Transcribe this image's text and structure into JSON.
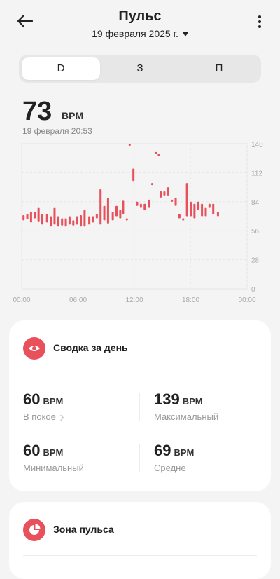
{
  "header": {
    "title": "Пульс",
    "date": "19 февраля 2025 г."
  },
  "tabs": [
    {
      "label": "D",
      "active": true
    },
    {
      "label": "З",
      "active": false
    },
    {
      "label": "П",
      "active": false
    }
  ],
  "current": {
    "value": "73",
    "unit": "BPM",
    "timestamp": "19 февраля 20:53"
  },
  "chart_data": {
    "type": "bar",
    "y_ticks": [
      "140",
      "112",
      "84",
      "56",
      "28",
      "0"
    ],
    "x_ticks": [
      "00:00",
      "06:00",
      "12:00",
      "18:00",
      "00:00"
    ],
    "ylim": [
      0,
      140
    ],
    "xlim_hours": [
      0,
      24
    ],
    "accent": "#e8505b",
    "series": [
      {
        "values": [
          [
            0.2,
            66,
            71
          ],
          [
            0.6,
            67,
            72
          ],
          [
            1.0,
            64,
            74
          ],
          [
            1.4,
            68,
            74
          ],
          [
            1.8,
            65,
            78
          ],
          [
            2.2,
            62,
            72
          ],
          [
            2.7,
            64,
            72
          ],
          [
            3.1,
            60,
            70
          ],
          [
            3.5,
            62,
            78
          ],
          [
            3.9,
            60,
            70
          ],
          [
            4.3,
            61,
            68
          ],
          [
            4.7,
            60,
            68
          ],
          [
            5.1,
            62,
            70
          ],
          [
            5.5,
            61,
            66
          ],
          [
            5.9,
            62,
            70
          ],
          [
            6.3,
            60,
            71
          ],
          [
            6.7,
            60,
            76
          ],
          [
            7.2,
            62,
            70
          ],
          [
            7.6,
            64,
            70
          ],
          [
            8.0,
            68,
            72
          ],
          [
            8.4,
            62,
            96
          ],
          [
            8.8,
            66,
            80
          ],
          [
            9.2,
            63,
            88
          ],
          [
            9.7,
            66,
            74
          ],
          [
            10.1,
            70,
            80
          ],
          [
            10.5,
            68,
            76
          ],
          [
            10.8,
            72,
            85
          ],
          [
            11.2,
            66,
            68
          ],
          [
            11.5,
            139,
            140
          ],
          [
            11.9,
            104,
            116
          ],
          [
            12.3,
            80,
            84
          ],
          [
            12.7,
            78,
            82
          ],
          [
            13.1,
            76,
            82
          ],
          [
            13.6,
            78,
            86
          ],
          [
            13.9,
            100,
            102
          ],
          [
            14.3,
            130,
            132
          ],
          [
            14.6,
            128,
            130
          ],
          [
            14.8,
            88,
            94
          ],
          [
            15.2,
            90,
            94
          ],
          [
            15.6,
            90,
            98
          ],
          [
            16.0,
            84,
            86
          ],
          [
            16.4,
            80,
            88
          ],
          [
            16.8,
            68,
            72
          ],
          [
            17.2,
            66,
            68
          ],
          [
            17.6,
            70,
            102
          ],
          [
            18.0,
            70,
            84
          ],
          [
            18.4,
            68,
            82
          ],
          [
            18.8,
            76,
            84
          ],
          [
            19.2,
            70,
            82
          ],
          [
            19.6,
            70,
            78
          ],
          [
            20.0,
            78,
            82
          ],
          [
            20.4,
            72,
            82
          ],
          [
            20.9,
            70,
            74
          ]
        ]
      }
    ]
  },
  "summary": {
    "title": "Сводка за день",
    "rest_value": "60",
    "rest_unit": "BPM",
    "rest_label": "В покое",
    "max_value": "139",
    "max_unit": "BPM",
    "max_label": "Максимальный",
    "min_value": "60",
    "min_unit": "BPM",
    "min_label": "Минимальный",
    "avg_value": "69",
    "avg_unit": "BPM",
    "avg_label": "Средне"
  },
  "zone": {
    "title": "Зона пульса"
  },
  "icons": {
    "back": "arrow-left-icon",
    "menu": "more-vertical-icon",
    "summary": "eye-icon",
    "zone": "pie-chart-icon"
  }
}
